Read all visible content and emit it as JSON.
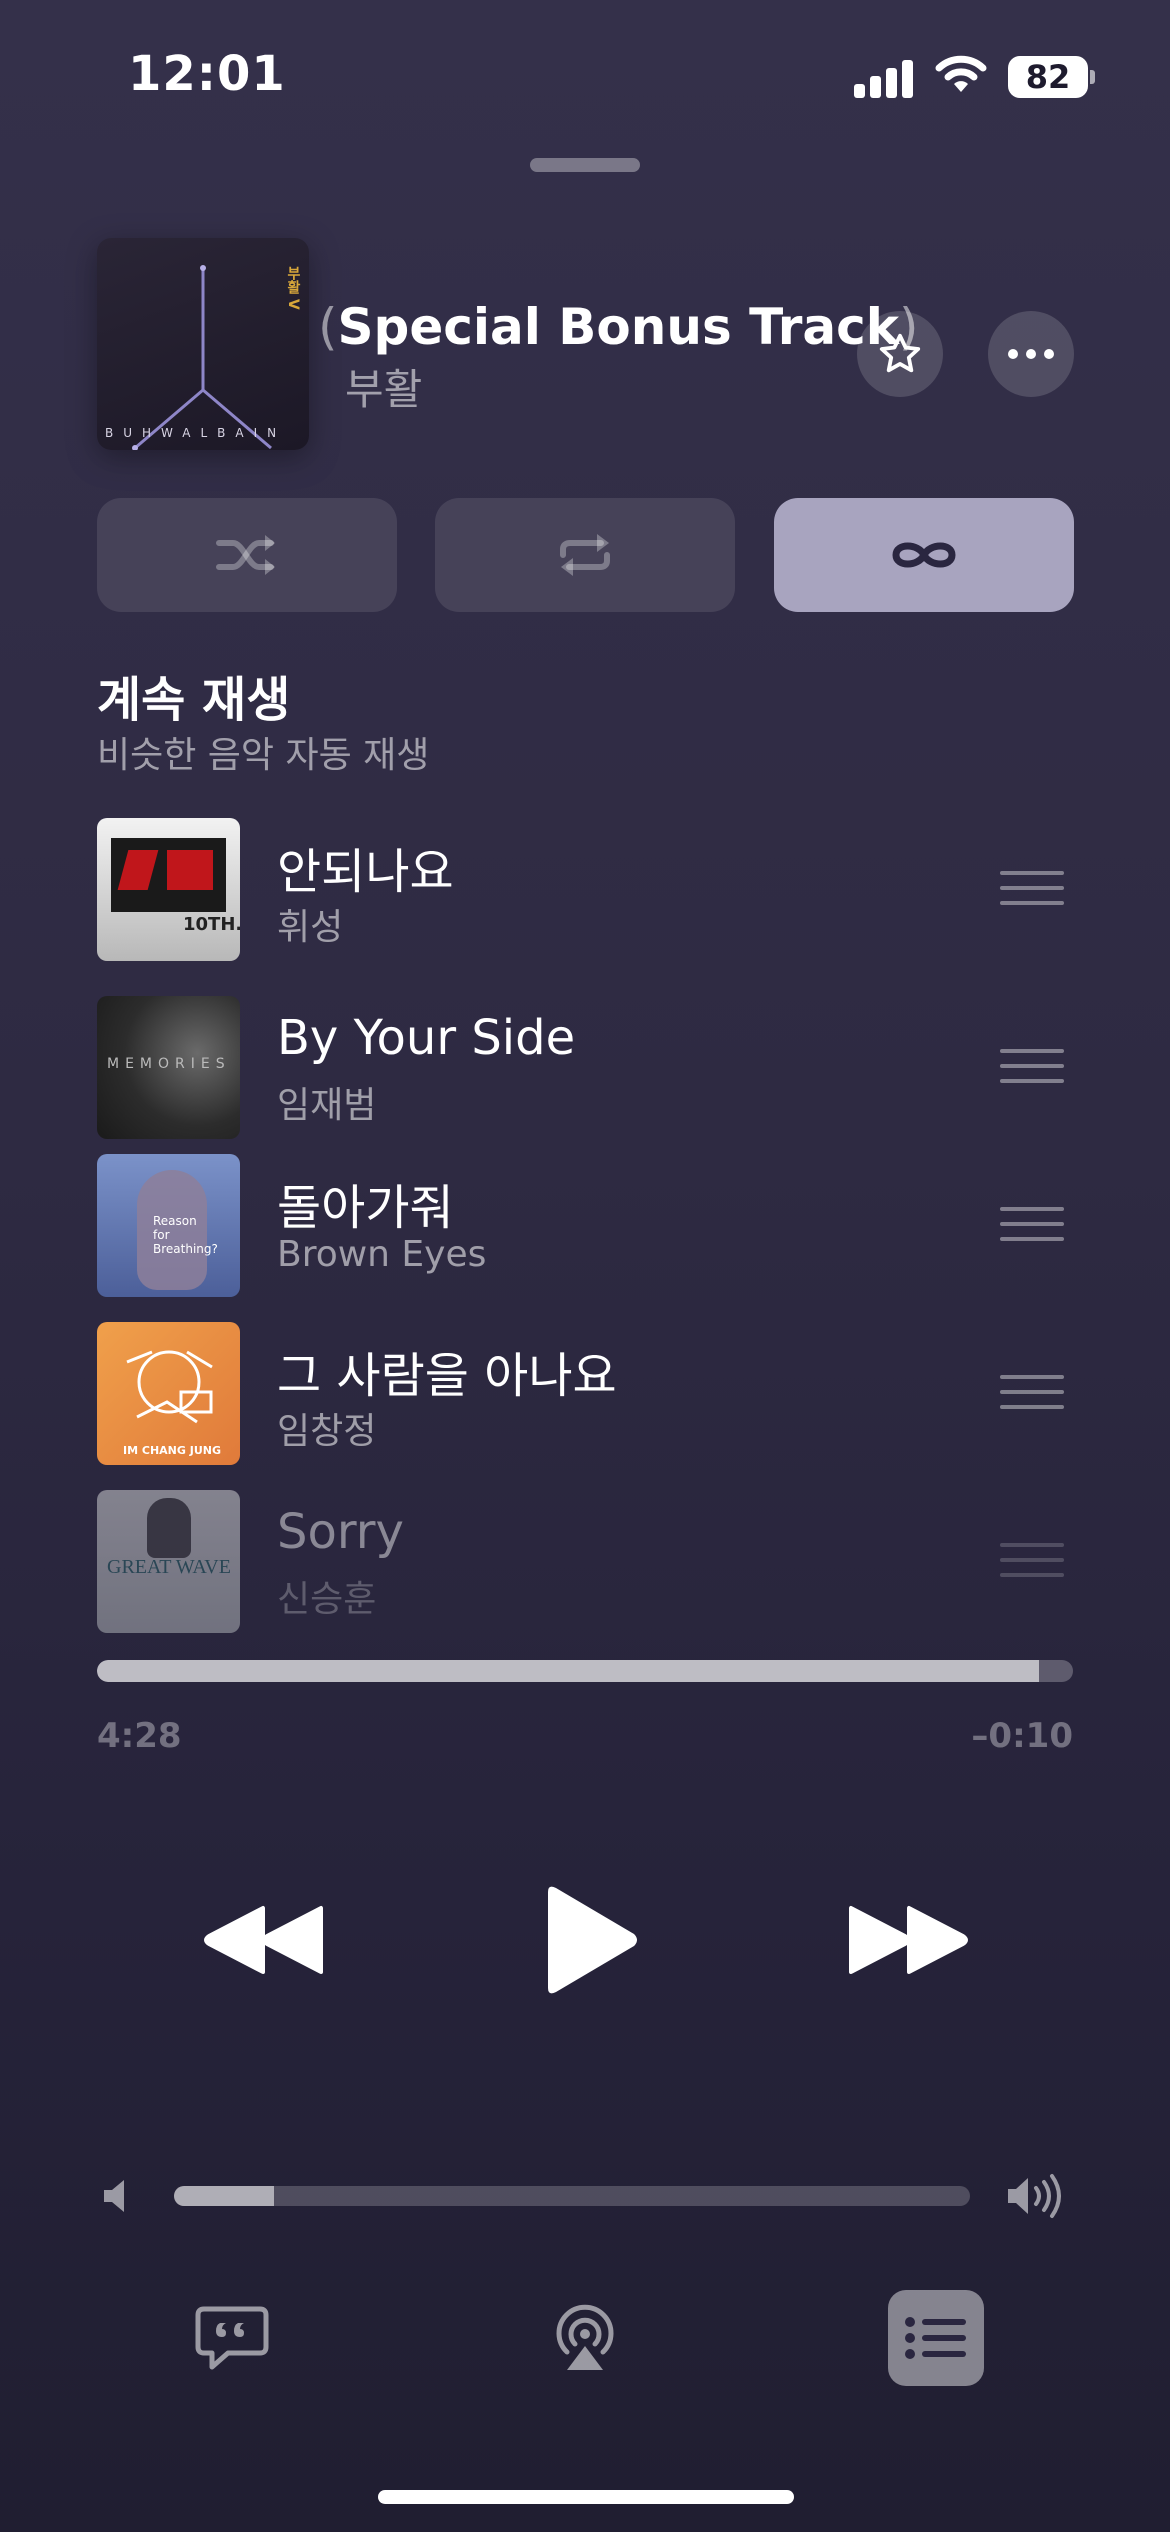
{
  "status_bar": {
    "time": "12:01",
    "battery": "82"
  },
  "now_playing": {
    "title_open_paren": "(",
    "title": "Special Bonus Track",
    "title_close_paren": ")",
    "artist": "부활",
    "album_art_text": "BUHWALBAIN",
    "album_art_vertical": "부활 V"
  },
  "modes": {
    "shuffle": {
      "icon": "shuffle-icon",
      "active": false
    },
    "repeat": {
      "icon": "repeat-icon",
      "active": false
    },
    "autoplay": {
      "icon": "infinity-icon",
      "active": true
    }
  },
  "queue_section": {
    "title": "계속 재생",
    "subtitle": "비슷한 음악 자동 재생"
  },
  "queue": [
    {
      "title": "안되나요",
      "artist": "휘성",
      "art_text": "10TH."
    },
    {
      "title": "By Your Side",
      "artist": "임재범",
      "art_text": "MEMORIES"
    },
    {
      "title": "돌아가줘",
      "artist": "Brown Eyes",
      "art_text": "Reason for Breathing?"
    },
    {
      "title": "그 사람을 아나요",
      "artist": "임창정",
      "art_text": "IM CHANG JUNG"
    },
    {
      "title": "Sorry",
      "artist": "신승훈",
      "art_text": "GREAT WAVE"
    }
  ],
  "playback": {
    "elapsed": "4:28",
    "remaining": "–0:10",
    "progress_fraction": 0.965
  },
  "volume": {
    "level_fraction": 0.125
  },
  "colors": {
    "accent_active": "#a8a4bf",
    "background_top": "#34304a",
    "background_bottom": "#201e31"
  }
}
